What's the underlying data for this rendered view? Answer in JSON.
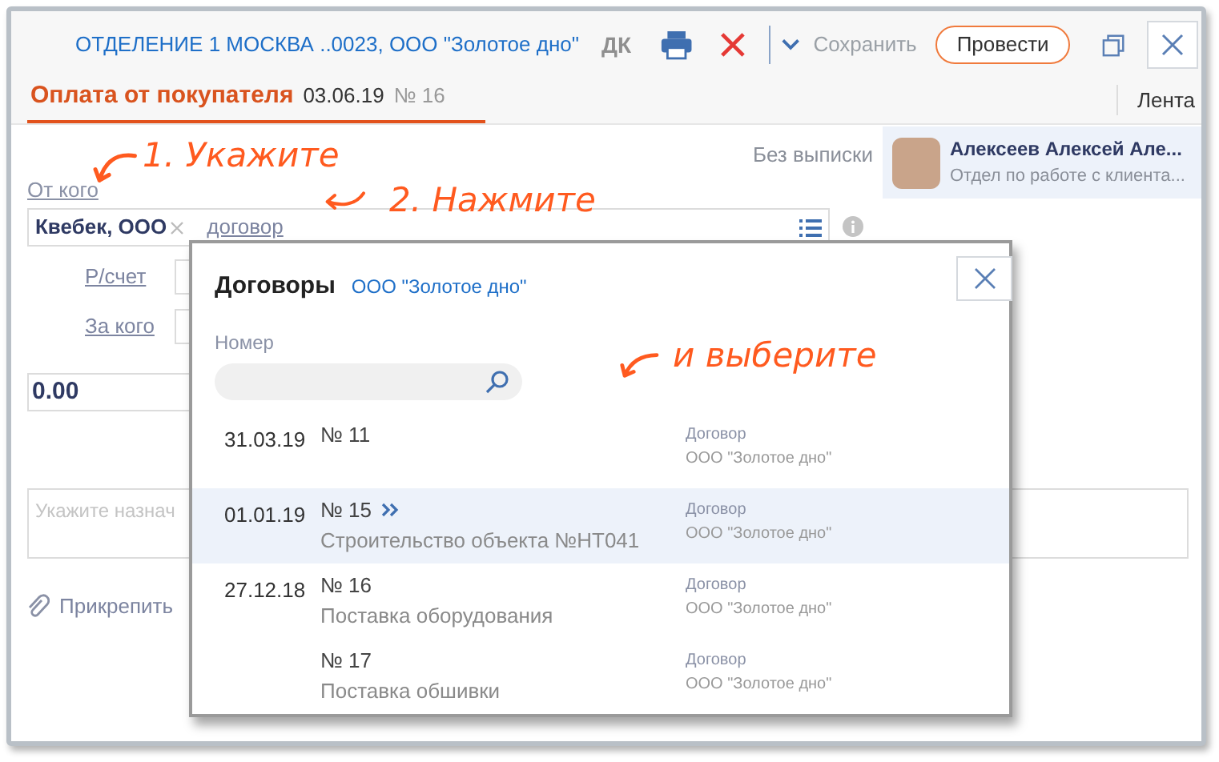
{
  "header": {
    "title": "ОТДЕЛЕНИЕ 1 МОСКВА ..0023, ООО \"Золотое дно\"",
    "code": "ДК",
    "save": "Сохранить",
    "post": "Провести"
  },
  "document": {
    "title": "Оплата от покупателя",
    "date": "03.06.19",
    "number": "№ 16",
    "feed": "Лента"
  },
  "statement": "Без выписки",
  "employee": {
    "name": "Алексеев Алексей Але...",
    "department": "Отдел по работе с клиента..."
  },
  "form": {
    "from_label": "От кого",
    "from_value": "Квебек, ООО",
    "contract_link": "договор",
    "account_label": "Р/счет",
    "for_whom_label": "За кого",
    "amount": "0.00",
    "purpose_placeholder": "Укажите назнач",
    "attach": "Прикрепить"
  },
  "annotations": [
    "1. Укажите",
    "2. Нажмите",
    "и выберите"
  ],
  "dialog": {
    "title": "Договоры",
    "organization": "ООО \"Золотое дно\"",
    "search_label": "Номер",
    "rows": [
      {
        "date": "31.03.19",
        "number": "№ 11",
        "type": "Договор",
        "organization": "ООО \"Золотое дно\"",
        "selected": false
      },
      {
        "date": "01.01.19",
        "number": "№ 15",
        "subject": "Строительство объекта №НТ041",
        "type": "Договор",
        "organization": "ООО \"Золотое дно\"",
        "selected": true
      },
      {
        "date": "27.12.18",
        "number": "№ 16",
        "subject": "Поставка оборудования",
        "type": "Договор",
        "organization": "ООО \"Золотое дно\"",
        "selected": false
      },
      {
        "number": "№ 17",
        "subject": "Поставка обшивки",
        "type": "Договор",
        "organization": "ООО \"Золотое дно\"",
        "selected": false
      }
    ]
  }
}
